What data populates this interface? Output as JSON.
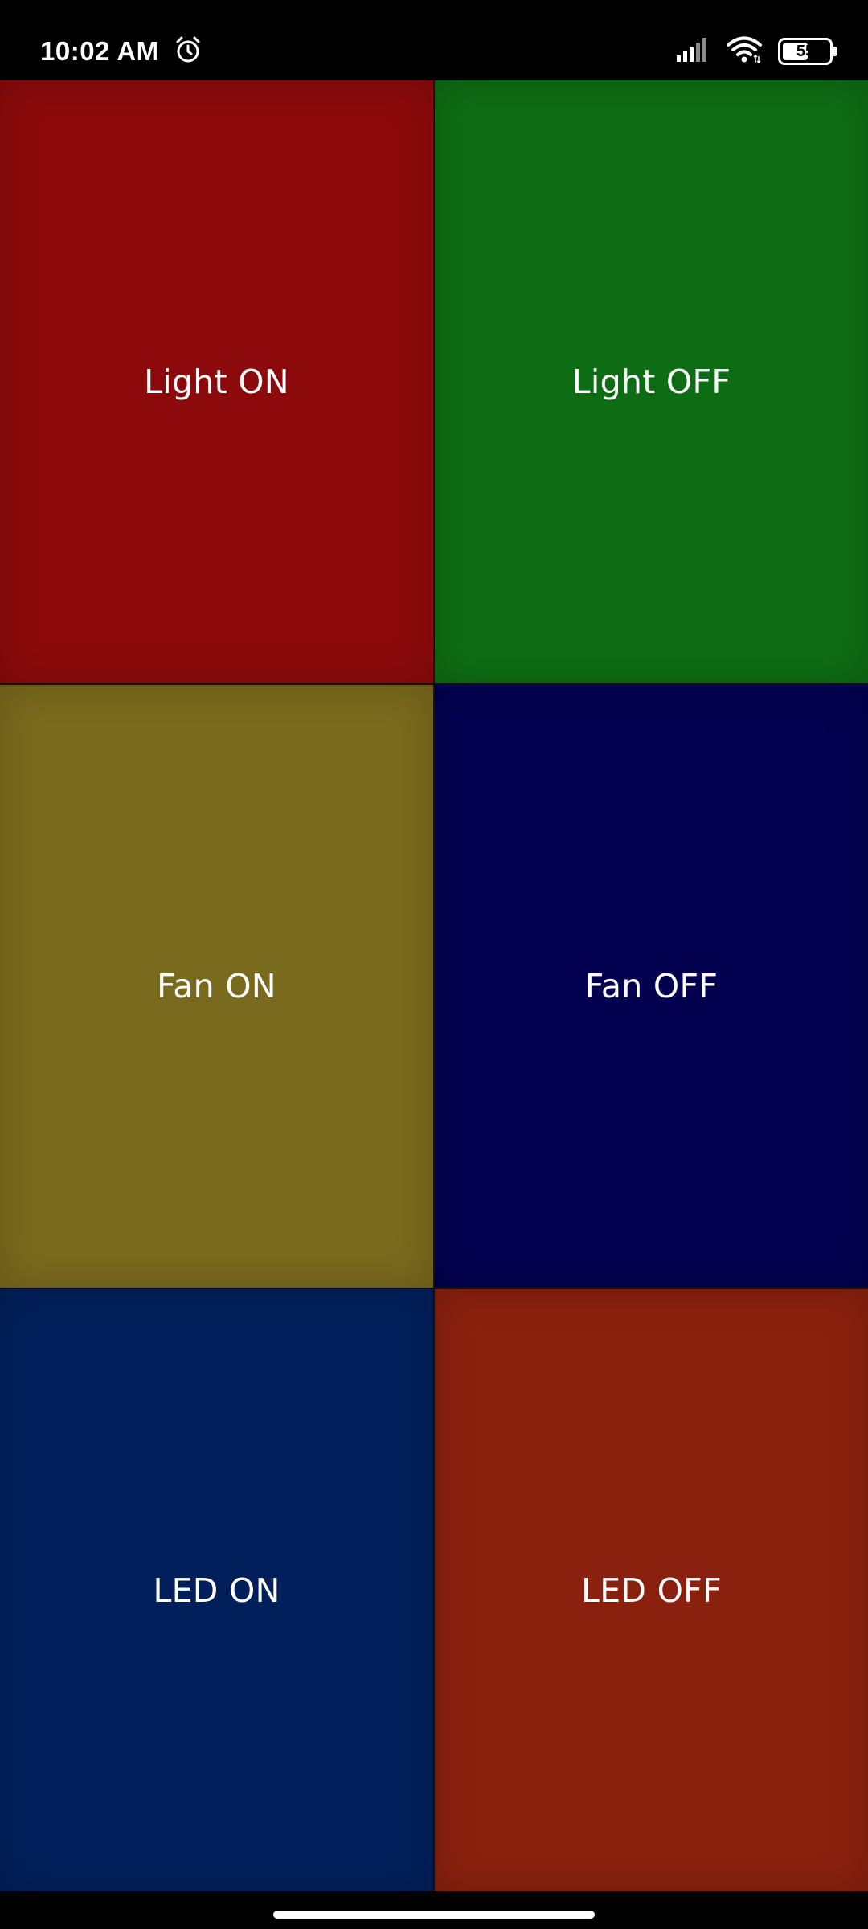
{
  "status_bar": {
    "time": "10:02 AM",
    "battery_level": "55",
    "battery_fraction": 0.55,
    "icons": [
      "alarm-icon",
      "signal-icon",
      "wifi-icon",
      "battery-icon"
    ]
  },
  "buttons": [
    {
      "label": "Light ON",
      "color": "#8c0a0b"
    },
    {
      "label": "Light OFF",
      "color": "#0e6d14"
    },
    {
      "label": "Fan ON",
      "color": "#7a6a1d"
    },
    {
      "label": "Fan OFF",
      "color": "#02004f"
    },
    {
      "label": "LED ON",
      "color": "#001f5a"
    },
    {
      "label": "LED OFF",
      "color": "#8a200e"
    }
  ]
}
